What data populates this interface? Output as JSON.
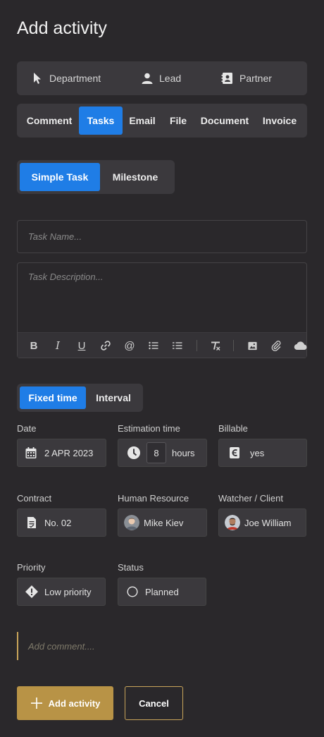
{
  "page_title": "Add activity",
  "relation_tabs": [
    {
      "label": "Department",
      "icon": "cursor-icon"
    },
    {
      "label": "Lead",
      "icon": "person-icon"
    },
    {
      "label": "Partner",
      "icon": "contact-book-icon"
    }
  ],
  "activity_types": [
    "Comment",
    "Tasks",
    "Email",
    "File",
    "Document",
    "Invoice"
  ],
  "activity_type_selected": "Tasks",
  "task_kind": {
    "options": [
      "Simple Task",
      "Milestone"
    ],
    "selected": "Simple Task"
  },
  "task_name": {
    "placeholder": "Task Name..."
  },
  "task_description": {
    "placeholder": "Task Description..."
  },
  "editor_toolbar": [
    "bold-icon",
    "italic-icon",
    "underline-icon",
    "link-icon",
    "mention-icon",
    "bullet-list-icon",
    "numbered-list-icon",
    "clear-format-icon",
    "image-icon",
    "attachment-icon",
    "cloud-icon"
  ],
  "time_mode": {
    "options": [
      "Fixed time",
      "Interval"
    ],
    "selected": "Fixed time"
  },
  "fields": {
    "date": {
      "label": "Date",
      "value": "2 APR 2023"
    },
    "estimation": {
      "label": "Estimation time",
      "amount": "8",
      "unit": "hours"
    },
    "billable": {
      "label": "Billable",
      "value": "yes"
    },
    "contract": {
      "label": "Contract",
      "value": "No. 02"
    },
    "human_resource": {
      "label": "Human Resource",
      "value": "Mike Kiev"
    },
    "watcher": {
      "label": "Watcher / Client",
      "value": "Joe William"
    },
    "priority": {
      "label": "Priority",
      "value": "Low priority"
    },
    "status": {
      "label": "Status",
      "value": "Planned"
    }
  },
  "comment": {
    "placeholder": "Add comment...."
  },
  "actions": {
    "add_label": "Add activity",
    "cancel_label": "Cancel"
  },
  "colors": {
    "background": "#2a282b",
    "accent_blue": "#1f7de6",
    "accent_gold": "#b89346"
  }
}
